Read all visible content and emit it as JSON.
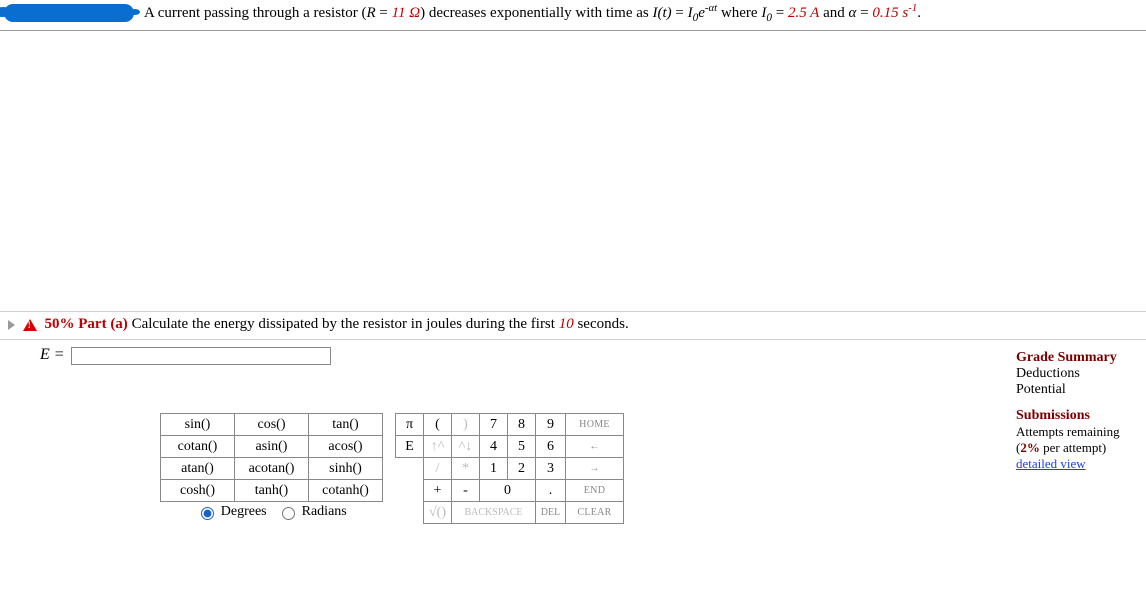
{
  "problem": {
    "prefix": "A current passing through a resistor (",
    "R_sym": "R",
    "eq1": " = ",
    "R_val": "11 Ω",
    "mid1": ") decreases exponentially with time as ",
    "Ieq_lhs": "I(t)",
    "eq2": " = ",
    "Ieq_rhs_base": "I",
    "Ieq_rhs_sub": "0",
    "Ieq_e": "e",
    "Ieq_exp": "-αt",
    "mid2": " where ",
    "I0_sym_base": "I",
    "I0_sym_sub": "0",
    "eq3": " = ",
    "I0_val": "2.5 A",
    "mid3": " and ",
    "alpha_sym": "α",
    "eq4": " = ",
    "alpha_val": "0.15 s",
    "alpha_exp": "-1",
    "tail": "."
  },
  "part": {
    "pct": "50% Part (a)",
    "text1": "  Calculate the energy dissipated by the resistor in joules during the first ",
    "ten": "10",
    "text2": " seconds."
  },
  "answer": {
    "label": "E =",
    "value": ""
  },
  "funcs": {
    "r1": [
      "sin()",
      "cos()",
      "tan()"
    ],
    "r2": [
      "cotan()",
      "asin()",
      "acos()"
    ],
    "r3": [
      "atan()",
      "acotan()",
      "sinh()"
    ],
    "r4": [
      "cosh()",
      "tanh()",
      "cotanh()"
    ],
    "modeDeg": "Degrees",
    "modeRad": "Radians"
  },
  "nums": {
    "r1": [
      "π",
      "(",
      ")",
      "7",
      "8",
      "9",
      "HOME"
    ],
    "r2": [
      "E",
      "↑^",
      "^↓",
      "4",
      "5",
      "6",
      "←"
    ],
    "r3": [
      "/",
      "*",
      "1",
      "2",
      "3",
      "→"
    ],
    "r4": [
      "+",
      "-",
      "0",
      ".",
      "END"
    ],
    "r5": [
      "√()",
      "BACKSPACE",
      "DEL",
      "CLEAR"
    ]
  },
  "grade": {
    "head": "Grade Summary",
    "ded": "Deductions",
    "pot": "Potential",
    "subh": "Submissions",
    "att": "Attempts remaining",
    "penalty_pre": "(",
    "penalty_pct": "2%",
    "penalty_post": " per attempt)",
    "link": "detailed view"
  }
}
